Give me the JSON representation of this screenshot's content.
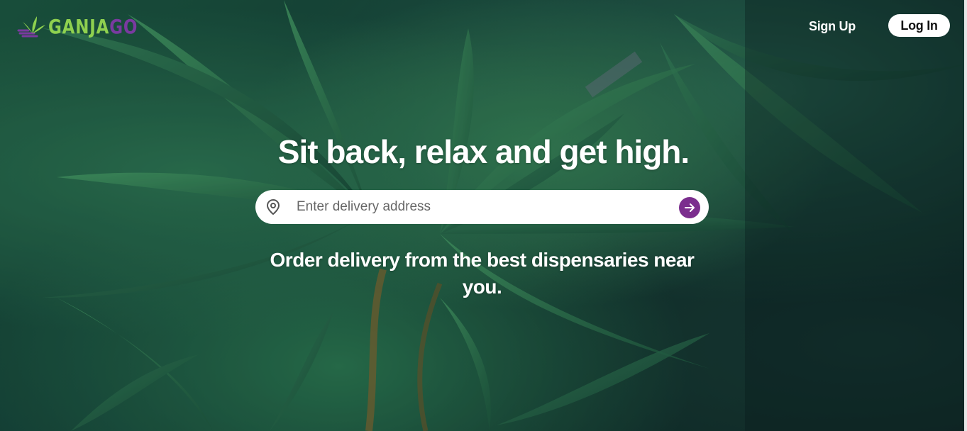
{
  "brand": {
    "logo_part1": "GANJA",
    "logo_part2": "GO",
    "colors": {
      "green": "#8fd14f",
      "purple": "#7a3aa0"
    }
  },
  "nav": {
    "signup_label": "Sign Up",
    "login_label": "Log In"
  },
  "hero": {
    "headline": "Sit back, relax and get high.",
    "search": {
      "placeholder": "Enter delivery address",
      "value": "",
      "pin_icon": "map-pin-icon",
      "submit_icon": "arrow-right-icon",
      "submit_color": "#7b2e8e"
    },
    "subheadline": "Order delivery from the best dispensaries near you."
  }
}
